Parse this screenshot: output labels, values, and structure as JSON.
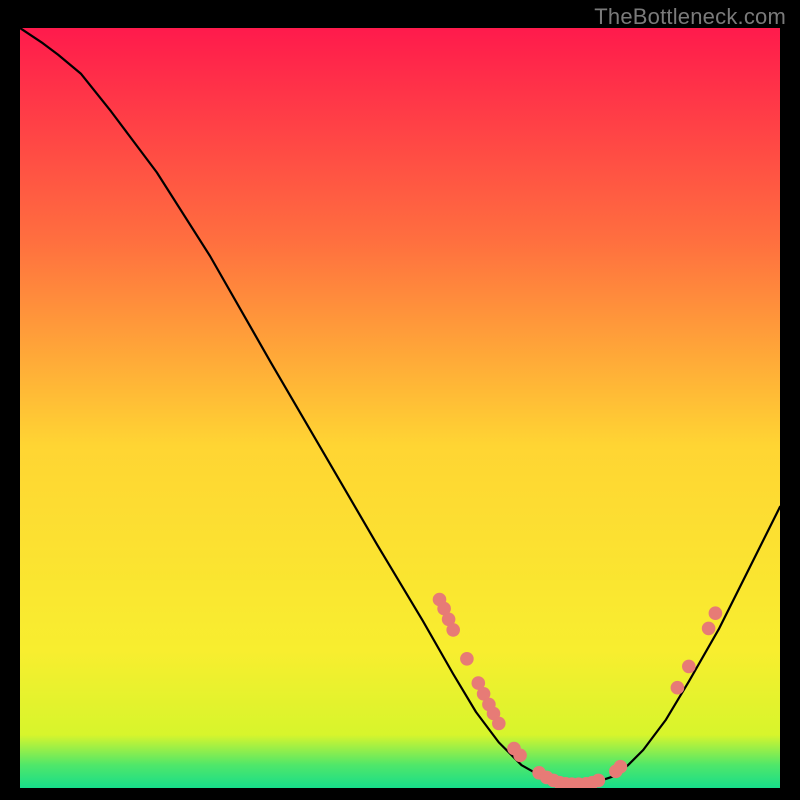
{
  "watermark": "TheBottleneck.com",
  "colors": {
    "background": "#000000",
    "curve": "#000000",
    "dots": "#e77b76",
    "gradient_top": "#ff1a4c",
    "gradient_mid_upper": "#ff6f3f",
    "gradient_mid": "#ffd533",
    "gradient_mid_lower": "#f8ee2f",
    "gradient_pre_green": "#d7f52c",
    "gradient_green1": "#4fe76a",
    "gradient_green2": "#17dd8a"
  },
  "chart_data": {
    "type": "line",
    "title": "",
    "xlabel": "",
    "ylabel": "",
    "xlim": [
      0,
      100
    ],
    "ylim": [
      0,
      100
    ],
    "series": [
      {
        "name": "bottleneck-curve",
        "x": [
          0,
          3,
          5,
          8,
          12,
          18,
          25,
          33,
          40,
          47,
          53,
          57,
          60,
          63,
          66,
          69,
          72,
          75,
          78,
          80,
          82,
          85,
          88,
          92,
          96,
          100
        ],
        "y": [
          100,
          98,
          96.5,
          94,
          89,
          81,
          70,
          56,
          44,
          32,
          22,
          15,
          10,
          6,
          3,
          1.3,
          0.5,
          0.5,
          1.5,
          3,
          5,
          9,
          14,
          21,
          29,
          37
        ]
      }
    ],
    "points": [
      {
        "name": "cluster-left-upper",
        "x": 55.2,
        "y": 24.8
      },
      {
        "name": "cluster-left-upper",
        "x": 55.8,
        "y": 23.6
      },
      {
        "name": "cluster-left-upper",
        "x": 56.4,
        "y": 22.2
      },
      {
        "name": "cluster-left-upper",
        "x": 57.0,
        "y": 20.8
      },
      {
        "name": "cluster-left-mid",
        "x": 58.8,
        "y": 17.0
      },
      {
        "name": "cluster-left-mid",
        "x": 60.3,
        "y": 13.8
      },
      {
        "name": "cluster-left-mid",
        "x": 61.0,
        "y": 12.4
      },
      {
        "name": "cluster-left-mid",
        "x": 61.7,
        "y": 11.0
      },
      {
        "name": "cluster-left-mid",
        "x": 62.3,
        "y": 9.8
      },
      {
        "name": "cluster-left-mid",
        "x": 63.0,
        "y": 8.5
      },
      {
        "name": "cluster-basin-left",
        "x": 65.0,
        "y": 5.2
      },
      {
        "name": "cluster-basin-left",
        "x": 65.8,
        "y": 4.3
      },
      {
        "name": "cluster-basin",
        "x": 68.3,
        "y": 2.0
      },
      {
        "name": "cluster-basin",
        "x": 69.3,
        "y": 1.4
      },
      {
        "name": "cluster-basin",
        "x": 70.2,
        "y": 1.0
      },
      {
        "name": "cluster-basin",
        "x": 71.0,
        "y": 0.7
      },
      {
        "name": "cluster-basin",
        "x": 71.8,
        "y": 0.55
      },
      {
        "name": "cluster-basin",
        "x": 72.6,
        "y": 0.5
      },
      {
        "name": "cluster-basin",
        "x": 73.5,
        "y": 0.5
      },
      {
        "name": "cluster-basin",
        "x": 74.5,
        "y": 0.55
      },
      {
        "name": "cluster-basin",
        "x": 75.3,
        "y": 0.7
      },
      {
        "name": "cluster-basin",
        "x": 76.1,
        "y": 1.0
      },
      {
        "name": "cluster-basin-right",
        "x": 78.4,
        "y": 2.2
      },
      {
        "name": "cluster-basin-right",
        "x": 79.0,
        "y": 2.8
      },
      {
        "name": "cluster-right-mid",
        "x": 86.5,
        "y": 13.2
      },
      {
        "name": "cluster-right-mid",
        "x": 88.0,
        "y": 16.0
      },
      {
        "name": "cluster-right-upper",
        "x": 90.6,
        "y": 21.0
      },
      {
        "name": "cluster-right-upper",
        "x": 91.5,
        "y": 23.0
      }
    ]
  }
}
